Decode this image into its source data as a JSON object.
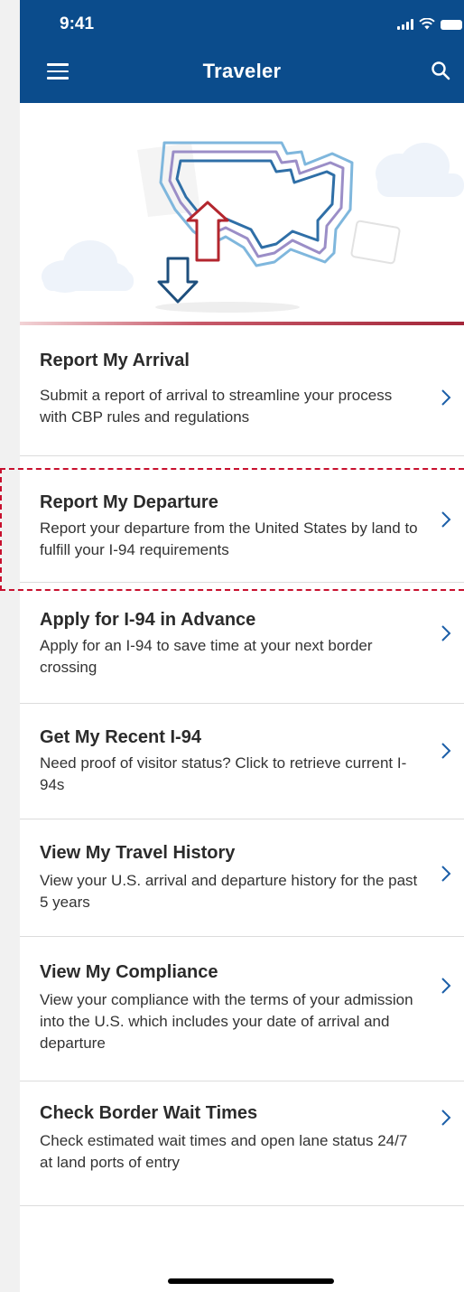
{
  "status_bar": {
    "time": "9:41"
  },
  "header": {
    "title": "Traveler"
  },
  "items": [
    {
      "title": "Report My Arrival",
      "desc": "Submit a report of arrival to streamline your process with CBP rules and regulations"
    },
    {
      "title": "Report My Departure",
      "desc": "Report your departure from the United States by land to fulfill your I-94 requirements"
    },
    {
      "title": "Apply for I-94 in Advance",
      "desc": "Apply for an I-94 to save time at your next border crossing"
    },
    {
      "title": "Get My Recent I-94",
      "desc": "Need proof of visitor status? Click to retrieve current I-94s"
    },
    {
      "title": "View My Travel History",
      "desc": "View your U.S. arrival and departure history for the past 5 years"
    },
    {
      "title": "View My Compliance",
      "desc": "View your compliance with the terms of your admission into the U.S. which includes your date of arrival and departure"
    },
    {
      "title": "Check Border Wait Times",
      "desc": "Check estimated wait times and open lane status 24/7 at land ports of entry"
    }
  ],
  "colors": {
    "header_bg": "#0b4c8c",
    "accent_red": "#c8102e",
    "chevron": "#1c5fa8"
  },
  "icons": [
    "menu-icon",
    "search-icon",
    "chevron-right-icon",
    "signal-icon",
    "wifi-icon",
    "battery-icon"
  ]
}
